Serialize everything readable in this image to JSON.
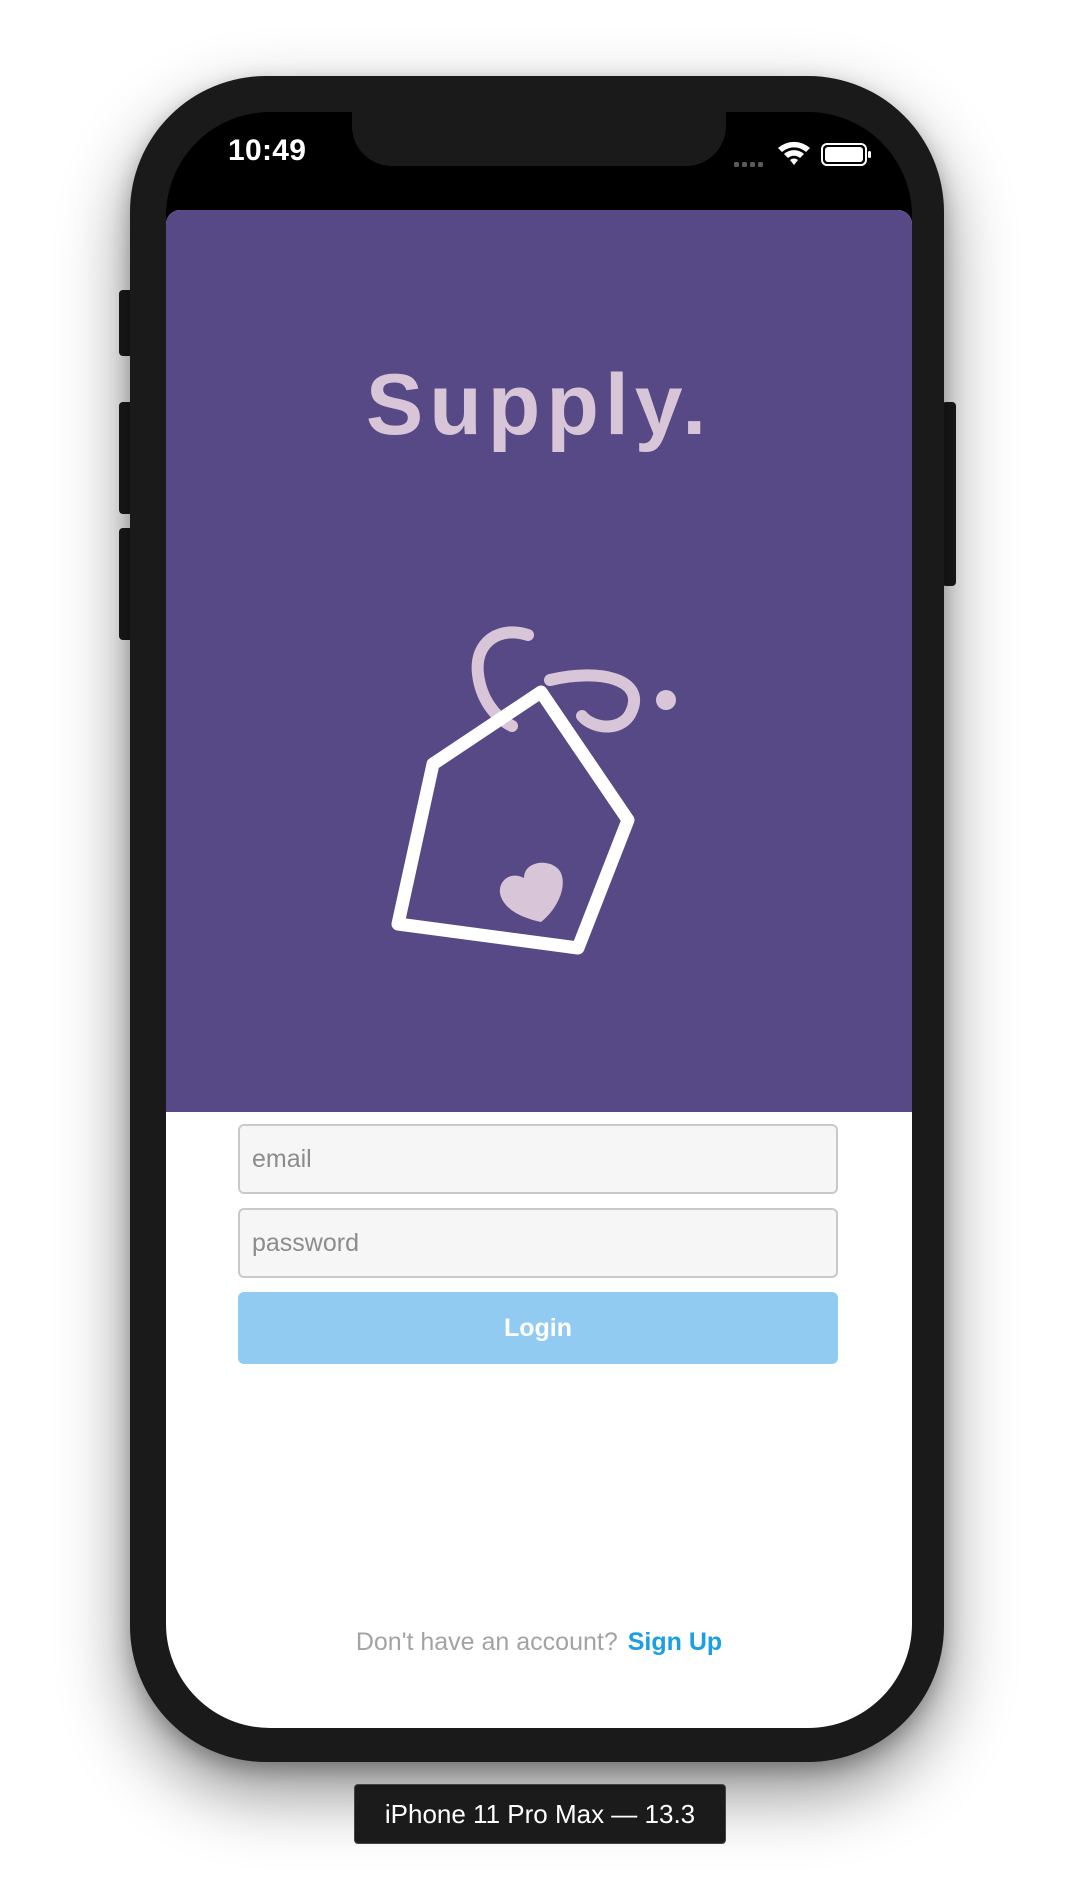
{
  "status_bar": {
    "time": "10:49",
    "icons": [
      "cellular-signal-icon",
      "wifi-icon",
      "battery-icon"
    ]
  },
  "app": {
    "title": "Supply.",
    "logo": "price-tag-heart-logo",
    "email_field": {
      "placeholder": "email",
      "value": ""
    },
    "password_field": {
      "placeholder": "password",
      "value": ""
    },
    "login_label": "Login",
    "signup_prompt": "Don't have an account?",
    "signup_link": "Sign Up"
  },
  "simulator": {
    "device_label": "iPhone 11 Pro Max — 13.3"
  },
  "colors": {
    "hero_background": "#564985",
    "title_color": "#d9c5d8",
    "login_button": "#92cbf2",
    "signup_link": "#1a9ee6"
  }
}
